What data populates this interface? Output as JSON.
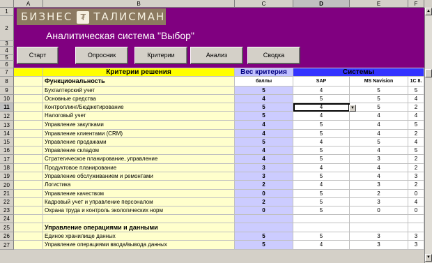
{
  "columns": [
    "A",
    "B",
    "C",
    "D",
    "E",
    "F"
  ],
  "rows": [
    "1",
    "2",
    "3",
    "4",
    "5",
    "6",
    "7",
    "8",
    "9",
    "10",
    "11",
    "12",
    "13",
    "14",
    "15",
    "16",
    "17",
    "18",
    "19",
    "20",
    "21",
    "22",
    "23",
    "24",
    "25",
    "26",
    "27"
  ],
  "banner": {
    "logo_left": "БИЗНЕС",
    "logo_right": "ТАЛИСМАН",
    "logo_mark": "₮",
    "title": "Аналитическая система \"Выбор\"",
    "buttons": [
      "Старт",
      "Опросник",
      "Критерии",
      "Анализ",
      "Сводка"
    ],
    "color": "#800080"
  },
  "headers": {
    "criteria": "Критерии решения",
    "weight": "Вес критерия",
    "systems": "Системы",
    "points": "баллы",
    "system_names": [
      "SAP",
      "MS Navision",
      "1С 8."
    ]
  },
  "groups": [
    {
      "title": "Функциональность",
      "icon": "functionality-icon",
      "rows": [
        {
          "name": "Бухгалтерский учет",
          "weight": "5",
          "scores": [
            "4",
            "5",
            "5"
          ]
        },
        {
          "name": "Основные средства",
          "weight": "4",
          "scores": [
            "5",
            "5",
            "4"
          ]
        },
        {
          "name": "Контроллинг/Бюджетирование",
          "weight": "5",
          "scores": [
            "4",
            "5",
            "2"
          ]
        },
        {
          "name": "Налоговый учет",
          "weight": "5",
          "scores": [
            "4",
            "4",
            "4"
          ]
        },
        {
          "name": "Управление закупками",
          "weight": "4",
          "scores": [
            "5",
            "4",
            "5"
          ]
        },
        {
          "name": "Управление клиентами (CRM)",
          "weight": "4",
          "scores": [
            "5",
            "4",
            "2"
          ]
        },
        {
          "name": "Управление продажами",
          "weight": "5",
          "scores": [
            "4",
            "5",
            "4"
          ]
        },
        {
          "name": "Управление складом",
          "weight": "4",
          "scores": [
            "5",
            "4",
            "5"
          ]
        },
        {
          "name": "Стратегическое планирование, управление",
          "weight": "4",
          "scores": [
            "5",
            "3",
            "2"
          ]
        },
        {
          "name": "Продуктовое планирование",
          "weight": "3",
          "scores": [
            "4",
            "4",
            "2"
          ]
        },
        {
          "name": "Управление обслуживанием и ремонтами",
          "weight": "3",
          "scores": [
            "5",
            "4",
            "3"
          ]
        },
        {
          "name": "Логистика",
          "weight": "2",
          "scores": [
            "4",
            "3",
            "2"
          ]
        },
        {
          "name": "Управление качеством",
          "weight": "0",
          "scores": [
            "5",
            "2",
            "0"
          ]
        },
        {
          "name": "Кадровый учет и управление персоналом",
          "weight": "2",
          "scores": [
            "5",
            "3",
            "4"
          ]
        },
        {
          "name": "Охрана труда и контроль экологических норм",
          "weight": "0",
          "scores": [
            "5",
            "0",
            "0"
          ]
        }
      ]
    },
    {
      "title": "Управление операциями и данными",
      "icon": "data-management-icon",
      "rows": [
        {
          "name": "Единое хранилище данных",
          "weight": "5",
          "scores": [
            "5",
            "3",
            "3"
          ]
        },
        {
          "name": "Управление операциями ввода/вывода данных",
          "weight": "5",
          "scores": [
            "4",
            "3",
            "3"
          ]
        }
      ]
    }
  ],
  "colors": {
    "criteria_bg": "#ffffcc",
    "weight_bg": "#ccccff",
    "systems_header": "#3333ff",
    "header_yellow": "#ffff00"
  },
  "selected_cell": "D11"
}
